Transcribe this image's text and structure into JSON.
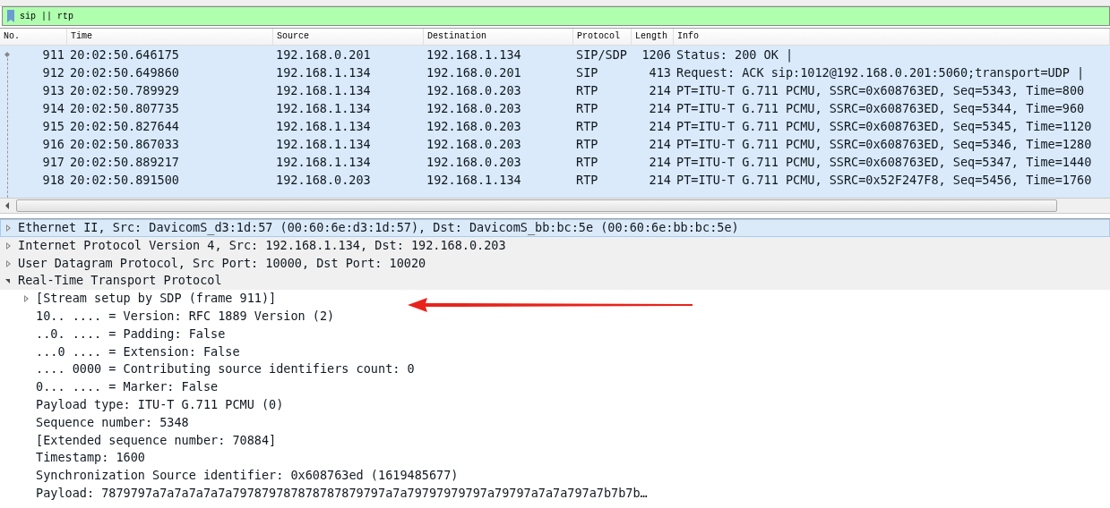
{
  "filter": {
    "value": "sip || rtp"
  },
  "packet_list": {
    "columns": [
      "No.",
      "Time",
      "Source",
      "Destination",
      "Protocol",
      "Length",
      "Info"
    ],
    "rows": [
      {
        "no": "911",
        "time": "20:02:50.646175",
        "source": "192.168.0.201",
        "destination": "192.168.1.134",
        "protocol": "SIP/SDP",
        "length": "1206",
        "info": "Status: 200 OK |",
        "related": true
      },
      {
        "no": "912",
        "time": "20:02:50.649860",
        "source": "192.168.1.134",
        "destination": "192.168.0.201",
        "protocol": "SIP",
        "length": "413",
        "info": "Request: ACK sip:1012@192.168.0.201:5060;transport=UDP |",
        "related": false
      },
      {
        "no": "913",
        "time": "20:02:50.789929",
        "source": "192.168.1.134",
        "destination": "192.168.0.203",
        "protocol": "RTP",
        "length": "214",
        "info": "PT=ITU-T G.711 PCMU, SSRC=0x608763ED, Seq=5343, Time=800",
        "related": false
      },
      {
        "no": "914",
        "time": "20:02:50.807735",
        "source": "192.168.1.134",
        "destination": "192.168.0.203",
        "protocol": "RTP",
        "length": "214",
        "info": "PT=ITU-T G.711 PCMU, SSRC=0x608763ED, Seq=5344, Time=960",
        "related": false
      },
      {
        "no": "915",
        "time": "20:02:50.827644",
        "source": "192.168.1.134",
        "destination": "192.168.0.203",
        "protocol": "RTP",
        "length": "214",
        "info": "PT=ITU-T G.711 PCMU, SSRC=0x608763ED, Seq=5345, Time=1120",
        "related": false
      },
      {
        "no": "916",
        "time": "20:02:50.867033",
        "source": "192.168.1.134",
        "destination": "192.168.0.203",
        "protocol": "RTP",
        "length": "214",
        "info": "PT=ITU-T G.711 PCMU, SSRC=0x608763ED, Seq=5346, Time=1280",
        "related": false
      },
      {
        "no": "917",
        "time": "20:02:50.889217",
        "source": "192.168.1.134",
        "destination": "192.168.0.203",
        "protocol": "RTP",
        "length": "214",
        "info": "PT=ITU-T G.711 PCMU, SSRC=0x608763ED, Seq=5347, Time=1440",
        "related": false
      },
      {
        "no": "918",
        "time": "20:02:50.891500",
        "source": "192.168.0.203",
        "destination": "192.168.1.134",
        "protocol": "RTP",
        "length": "214",
        "info": "PT=ITU-T G.711 PCMU, SSRC=0x52F247F8, Seq=5456, Time=1760",
        "related": false
      }
    ]
  },
  "packet_details": [
    {
      "label": "Ethernet II, Src: DavicomS_d3:1d:57 (00:60:6e:d3:1d:57), Dst: DavicomS_bb:bc:5e (00:60:6e:bb:bc:5e)",
      "expanded": false,
      "selected": true
    },
    {
      "label": "Internet Protocol Version 4, Src: 192.168.1.134, Dst: 192.168.0.203",
      "expanded": false,
      "selected": false
    },
    {
      "label": "User Datagram Protocol, Src Port: 10000, Dst Port: 10020",
      "expanded": false,
      "selected": false
    },
    {
      "label": "Real-Time Transport Protocol",
      "expanded": true,
      "selected": false,
      "children": [
        {
          "label": "[Stream setup by SDP (frame 911)]",
          "expandable": true
        },
        {
          "label": "10.. .... = Version: RFC 1889 Version (2)",
          "expandable": false
        },
        {
          "label": "..0. .... = Padding: False",
          "expandable": false
        },
        {
          "label": "...0 .... = Extension: False",
          "expandable": false
        },
        {
          "label": ".... 0000 = Contributing source identifiers count: 0",
          "expandable": false
        },
        {
          "label": "0... .... = Marker: False",
          "expandable": false
        },
        {
          "label": "Payload type: ITU-T G.711 PCMU (0)",
          "expandable": false
        },
        {
          "label": "Sequence number: 5348",
          "expandable": false
        },
        {
          "label": "[Extended sequence number: 70884]",
          "expandable": false
        },
        {
          "label": "Timestamp: 1600",
          "expandable": false
        },
        {
          "label": "Synchronization Source identifier: 0x608763ed (1619485677)",
          "expandable": false
        },
        {
          "label": "Payload: 7879797a7a7a7a7a7a797879787878787879797a7a79797979797a79797a7a7a797a7b7b7b…",
          "expandable": false
        }
      ]
    }
  ]
}
